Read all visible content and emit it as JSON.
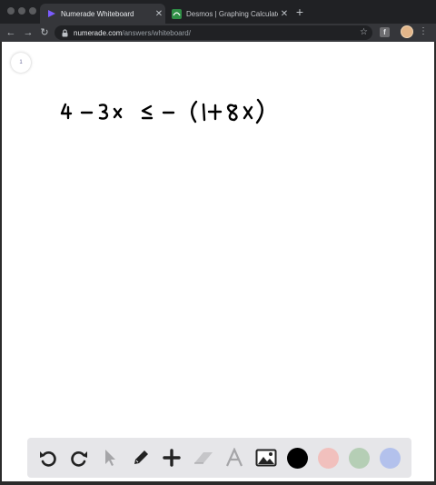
{
  "tabs": [
    {
      "title": "Numerade Whiteboard",
      "active": true,
      "icon": "numerade-logo-icon"
    },
    {
      "title": "Desmos | Graphing Calculator",
      "active": false,
      "icon": "desmos-logo-icon"
    }
  ],
  "address_bar": {
    "host": "numerade.com",
    "path": "/answers/whiteboard/"
  },
  "extension_label": "f",
  "whiteboard": {
    "page_number": "1",
    "handwriting": "4 − 3x ≤ − (1 + 8x)"
  },
  "toolbar": {
    "tools": [
      "undo-icon",
      "redo-icon",
      "select-pointer-icon",
      "pen-icon",
      "add-icon",
      "eraser-icon",
      "text-icon",
      "image-icon"
    ],
    "colors": [
      "#000000",
      "#f1c0bd",
      "#b5ceb5",
      "#b3c1ec"
    ]
  }
}
